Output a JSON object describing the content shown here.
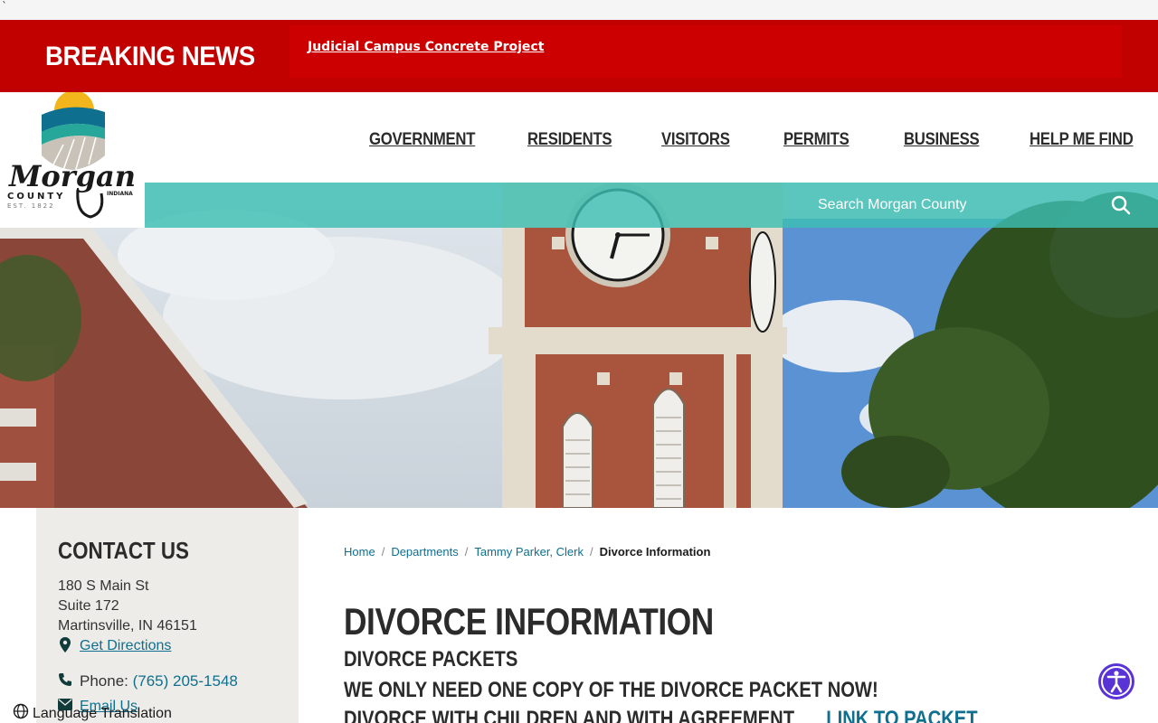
{
  "topstrip": {
    "mark": "`"
  },
  "breaking_news": {
    "title": "BREAKING NEWS",
    "link_text": "Judicial Campus Concrete Project"
  },
  "logo": {
    "name_text": "Morgan",
    "county_text": "COUNTY",
    "state_text": "INDIANA",
    "est_text": "EST. 1822"
  },
  "nav": {
    "items": [
      "GOVERNMENT",
      "RESIDENTS",
      "VISITORS",
      "PERMITS",
      "BUSINESS",
      "HELP ME FIND"
    ]
  },
  "search": {
    "placeholder": "Search Morgan County"
  },
  "sidebar": {
    "title": "CONTACT US",
    "address_line1": "180 S Main St",
    "address_line2": "Suite 172",
    "address_line3": "Martinsville, IN 46151",
    "directions_label": "Get Directions",
    "phone_label": "Phone: ",
    "phone_number": "(765) 205-1548",
    "email_label": "Email Us"
  },
  "language": {
    "label": "Language Translation"
  },
  "breadcrumb": {
    "items": [
      "Home",
      "Departments",
      "Tammy Parker, Clerk"
    ],
    "current": "Divorce Information"
  },
  "content": {
    "title": "DIVORCE INFORMATION",
    "heading1": "DIVORCE PACKETS",
    "heading2": "WE ONLY NEED ONE COPY OF THE DIVORCE PACKET NOW!",
    "heading3": "DIVORCE WITH CHILDREN AND WITH AGREEMENT",
    "heading3_link": "LINK TO PACKET"
  },
  "colors": {
    "breaking_red": "#c10000",
    "search_teal": "#3dbeb2",
    "link_teal": "#0e6f8f",
    "sidebar_bg": "#eeece8",
    "accessibility_purple": "#5a33d6"
  },
  "icons": {
    "search": "search-icon",
    "directions": "map-pin-icon",
    "phone": "phone-icon",
    "email": "envelope-icon",
    "language": "globe-icon",
    "accessibility": "accessibility-icon"
  }
}
